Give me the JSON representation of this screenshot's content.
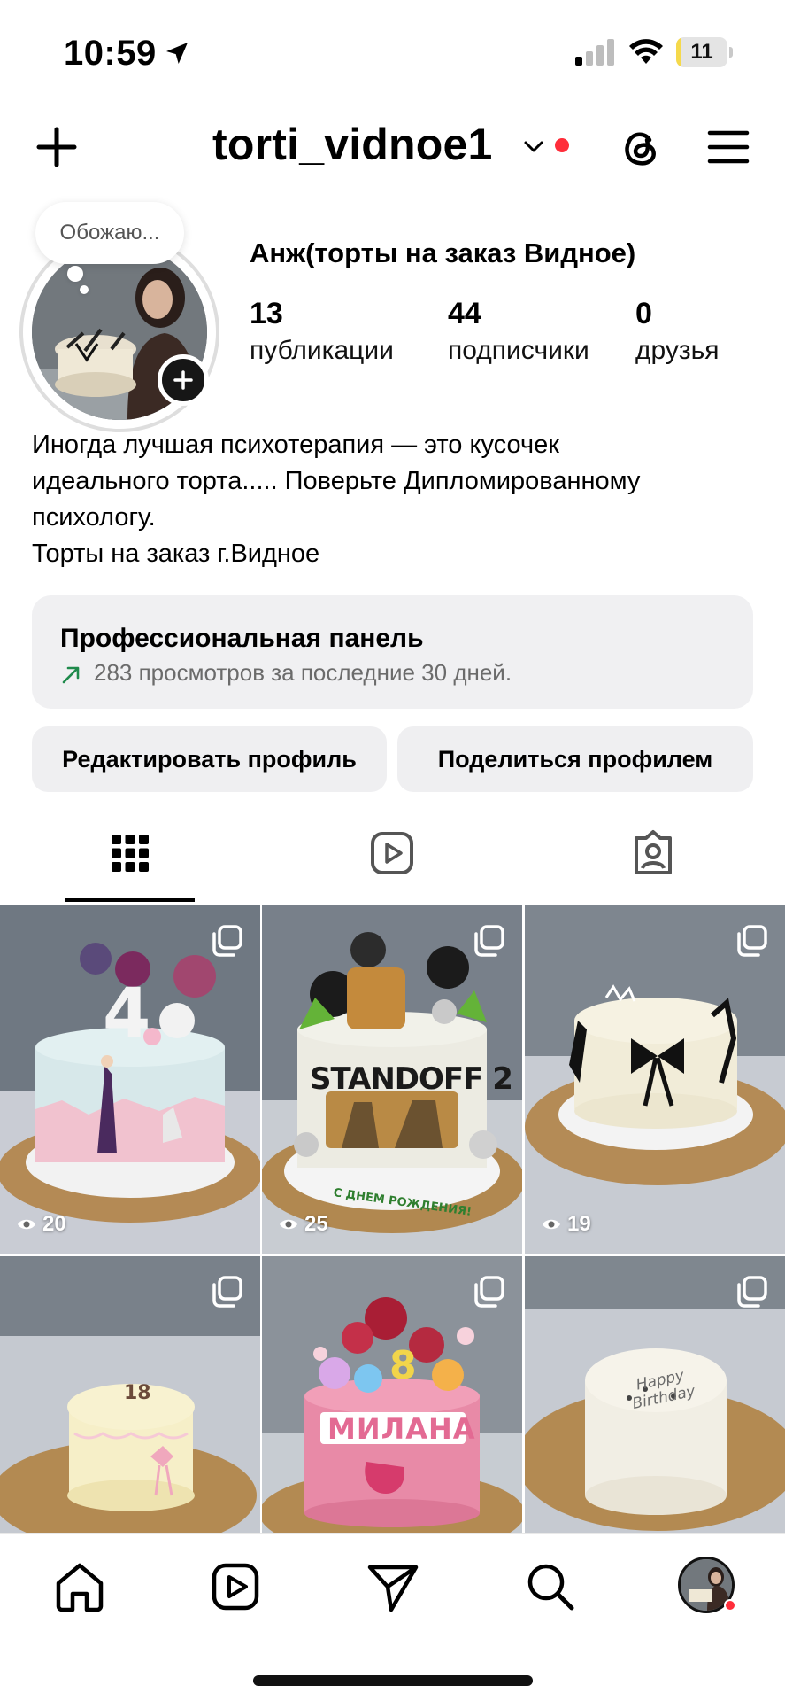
{
  "status_bar": {
    "time": "10:59",
    "battery": "11",
    "battery_level": 0.11
  },
  "header": {
    "username": "torti_vidnoe1"
  },
  "profile": {
    "note": "Обожаю...",
    "display_name": "Анж(торты на заказ Видное)",
    "stats": [
      {
        "value": "13",
        "label": "публикации"
      },
      {
        "value": "44",
        "label": "подписчики"
      },
      {
        "value": "0",
        "label": "друзья"
      }
    ],
    "bio_lines": [
      "Иногда лучшая психотерапия — это кусочек",
      "идеального торта..... Поверьте Дипломированному",
      "психологу.",
      "Торты на заказ г.Видное"
    ]
  },
  "pro_panel": {
    "title": "Профессиональная панель",
    "subtitle": "283 просмотров за последние 30 дней."
  },
  "buttons": {
    "edit": "Редактировать профиль",
    "share": "Поделиться профилем"
  },
  "posts": [
    {
      "views": "20",
      "cake_text": "4"
    },
    {
      "views": "25",
      "cake_text": "STANDOFF 2",
      "cake_sub": "С ДНЕМ РОЖДЕНИЯ!"
    },
    {
      "views": "19",
      "cake_text": ""
    },
    {
      "views": "",
      "cake_text": "18"
    },
    {
      "views": "",
      "cake_text": "МИЛАНА",
      "cake_sub": "8"
    },
    {
      "views": "",
      "cake_text": "Happy Birthday"
    }
  ],
  "icons": {
    "status": [
      "location-arrow-icon",
      "signal-icon",
      "wifi-icon",
      "battery-icon"
    ],
    "header": [
      "plus-icon",
      "chevron-down-icon",
      "threads-icon",
      "menu-icon"
    ],
    "tabs": [
      "grid-icon",
      "reels-icon",
      "tagged-icon"
    ],
    "nav": [
      "home-icon",
      "reels-icon",
      "send-icon",
      "search-icon",
      "profile-avatar"
    ]
  },
  "colors": {
    "notification_dot": "#ff2d3a",
    "battery_fill": "#f5d94b",
    "trend_arrow": "#1f8a4c"
  }
}
